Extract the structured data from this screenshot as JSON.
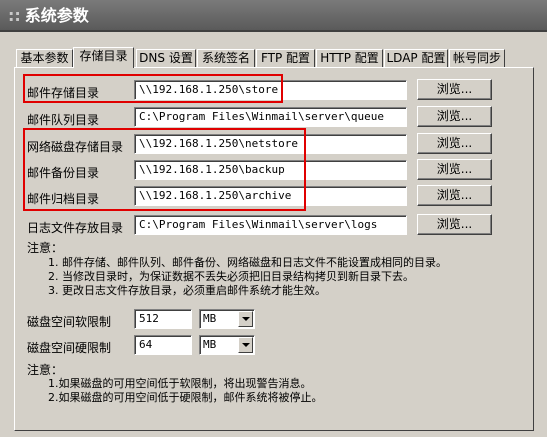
{
  "window": {
    "title_prefix": "::",
    "title": "系统参数"
  },
  "tabs": [
    {
      "label": "基本参数",
      "active": false
    },
    {
      "label": "存储目录",
      "active": true
    },
    {
      "label": "DNS 设置",
      "active": false
    },
    {
      "label": "系统签名",
      "active": false
    },
    {
      "label": "FTP 配置",
      "active": false
    },
    {
      "label": "HTTP 配置",
      "active": false
    },
    {
      "label": "LDAP 配置",
      "active": false
    },
    {
      "label": "帐号同步",
      "active": false
    }
  ],
  "directories": [
    {
      "label": "邮件存储目录",
      "value": "\\\\192.168.1.250\\store",
      "button": "浏览..."
    },
    {
      "label": "邮件队列目录",
      "value": "C:\\Program Files\\Winmail\\server\\queue",
      "button": "浏览..."
    },
    {
      "label": "网络磁盘存储目录",
      "value": "\\\\192.168.1.250\\netstore",
      "button": "浏览..."
    },
    {
      "label": "邮件备份目录",
      "value": "\\\\192.168.1.250\\backup",
      "button": "浏览..."
    },
    {
      "label": "邮件归档目录",
      "value": "\\\\192.168.1.250\\archive",
      "button": "浏览..."
    },
    {
      "label": "日志文件存放目录",
      "value": "C:\\Program Files\\Winmail\\server\\logs",
      "button": "浏览..."
    }
  ],
  "note1": {
    "heading": "注意：",
    "lines": [
      "1. 邮件存储、邮件队列、邮件备份、网络磁盘和日志文件不能设置成相同的目录。",
      "2. 当修改目录时，为保证数据不丢失必须把旧目录结构拷贝到新目录下去。",
      "3. 更改日志文件存放目录，必须重启邮件系统才能生效。"
    ]
  },
  "quota": {
    "soft": {
      "label": "磁盘空间软限制",
      "value": "512",
      "unit": "MB"
    },
    "hard": {
      "label": "磁盘空间硬限制",
      "value": "64",
      "unit": "MB"
    }
  },
  "note2": {
    "heading": "注意：",
    "lines": [
      "1.如果磁盘的可用空间低于软限制，将出现警告消息。",
      "2.如果磁盘的可用空间低于硬限制，邮件系统将被停止。"
    ]
  },
  "highlight_color": "#e00000"
}
